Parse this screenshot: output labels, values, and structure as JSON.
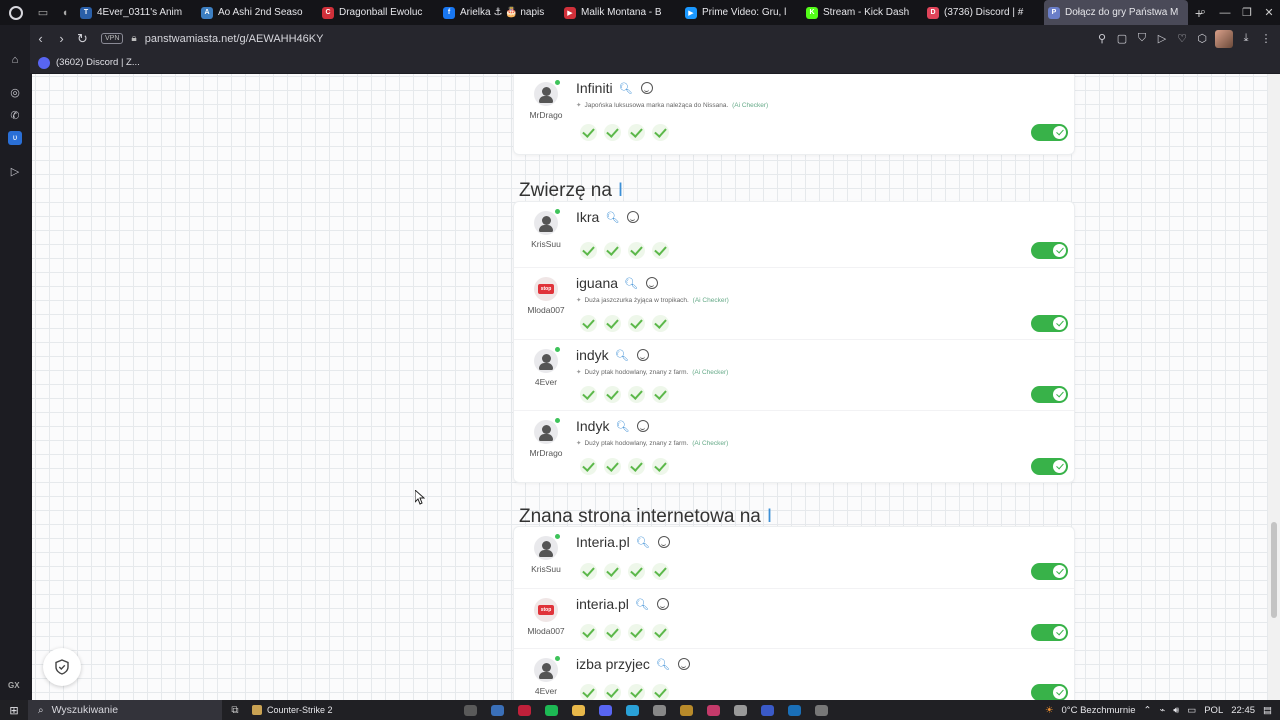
{
  "browser": {
    "tabs": [
      {
        "label": "4Ever_0311's Anim",
        "color": "#2a5fa8",
        "glyph": "T"
      },
      {
        "label": "Ao Ashi 2nd Seaso",
        "color": "#3d7fc2",
        "glyph": "A"
      },
      {
        "label": "Dragonball Ewoluc",
        "color": "#d0303a",
        "glyph": "C"
      },
      {
        "label": "Arielka ⚓ 🎂 napis",
        "color": "#1877f2",
        "glyph": "f"
      },
      {
        "label": "Malik Montana - B",
        "color": "#d0303a",
        "glyph": "▶"
      },
      {
        "label": "Prime Video: Gru, l",
        "color": "#1a98ff",
        "glyph": "▶"
      },
      {
        "label": "Stream - Kick Dash",
        "color": "#53fc18",
        "glyph": "K"
      },
      {
        "label": "(3736) Discord | #",
        "color": "#e0445a",
        "glyph": "D"
      },
      {
        "label": "Dołącz do gry Państwa M",
        "color": "#6a7ec8",
        "glyph": "P",
        "active": true
      }
    ],
    "new_tab": "+",
    "address": {
      "vpn": "VPN",
      "url": "panstwamiasta.net/g/AEWAHH46KY"
    },
    "bookmarks": [
      {
        "label": "(3602) Discord | Z..."
      }
    ]
  },
  "page": {
    "sections": [
      {
        "top_partial": true,
        "entries": [
          {
            "user": "MrDrago",
            "avatar": "person",
            "word": "Infiniti",
            "hint": "Japońska luksusowa marka należąca do Nissana.",
            "ai": "(Ai Checker)",
            "checks": 4,
            "accepted": true
          }
        ]
      },
      {
        "title": "Zwierzę na",
        "letter": "I",
        "entries": [
          {
            "user": "KrisSuu",
            "avatar": "person",
            "word": "Ikra",
            "hint": "",
            "ai": "",
            "checks": 4,
            "accepted": true
          },
          {
            "user": "Mloda007",
            "avatar": "stop",
            "word": "iguana",
            "hint": "Duża jaszczurka żyjąca w tropikach.",
            "ai": "(Ai Checker)",
            "checks": 4,
            "accepted": true
          },
          {
            "user": "4Ever",
            "avatar": "person",
            "word": "indyk",
            "hint": "Duży ptak hodowlany, znany z farm.",
            "ai": "(Ai Checker)",
            "checks": 4,
            "accepted": true
          },
          {
            "user": "MrDrago",
            "avatar": "person",
            "word": "Indyk",
            "hint": "Duży ptak hodowlany, znany z farm.",
            "ai": "(Ai Checker)",
            "checks": 4,
            "accepted": true
          }
        ]
      },
      {
        "title": "Znana strona internetowa na",
        "letter": "I",
        "entries": [
          {
            "user": "KrisSuu",
            "avatar": "person",
            "word": "Interia.pl",
            "hint": "",
            "ai": "",
            "checks": 4,
            "accepted": true
          },
          {
            "user": "Mloda007",
            "avatar": "stop",
            "word": "interia.pl",
            "hint": "",
            "ai": "",
            "checks": 4,
            "accepted": true
          },
          {
            "user": "4Ever",
            "avatar": "person",
            "word": "izba przyjec",
            "hint": "",
            "ai": "",
            "checks": 4,
            "accepted": true
          }
        ]
      }
    ],
    "stop_sign_text": "stop"
  },
  "taskbar": {
    "search_placeholder": "Wyszukiwanie",
    "running_app": "Counter-Strike 2",
    "weather": "0°C  Bezchmurnie",
    "language": "POL",
    "time": "22:45"
  },
  "colors": {
    "accent": "#3d8fd6",
    "toggle_on": "#38b249",
    "check": "#5cb84a",
    "online_dot": "#3ec35a"
  }
}
